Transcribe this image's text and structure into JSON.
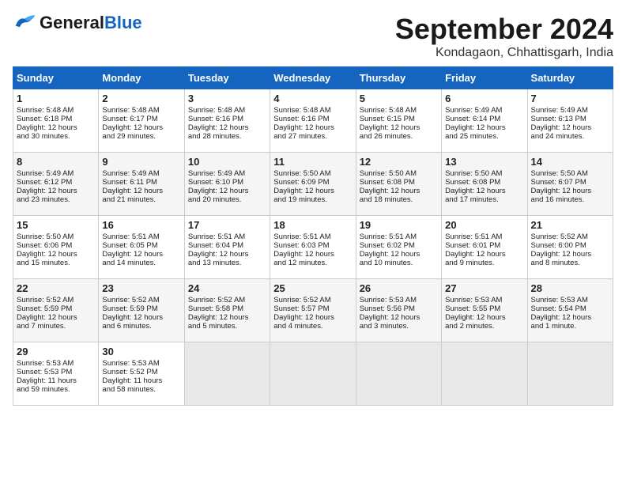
{
  "header": {
    "logo_general": "General",
    "logo_blue": "Blue",
    "month_title": "September 2024",
    "location": "Kondagaon, Chhattisgarh, India"
  },
  "weekdays": [
    "Sunday",
    "Monday",
    "Tuesday",
    "Wednesday",
    "Thursday",
    "Friday",
    "Saturday"
  ],
  "weeks": [
    [
      {
        "day": "1",
        "lines": [
          "Sunrise: 5:48 AM",
          "Sunset: 6:18 PM",
          "Daylight: 12 hours",
          "and 30 minutes."
        ]
      },
      {
        "day": "2",
        "lines": [
          "Sunrise: 5:48 AM",
          "Sunset: 6:17 PM",
          "Daylight: 12 hours",
          "and 29 minutes."
        ]
      },
      {
        "day": "3",
        "lines": [
          "Sunrise: 5:48 AM",
          "Sunset: 6:16 PM",
          "Daylight: 12 hours",
          "and 28 minutes."
        ]
      },
      {
        "day": "4",
        "lines": [
          "Sunrise: 5:48 AM",
          "Sunset: 6:16 PM",
          "Daylight: 12 hours",
          "and 27 minutes."
        ]
      },
      {
        "day": "5",
        "lines": [
          "Sunrise: 5:48 AM",
          "Sunset: 6:15 PM",
          "Daylight: 12 hours",
          "and 26 minutes."
        ]
      },
      {
        "day": "6",
        "lines": [
          "Sunrise: 5:49 AM",
          "Sunset: 6:14 PM",
          "Daylight: 12 hours",
          "and 25 minutes."
        ]
      },
      {
        "day": "7",
        "lines": [
          "Sunrise: 5:49 AM",
          "Sunset: 6:13 PM",
          "Daylight: 12 hours",
          "and 24 minutes."
        ]
      }
    ],
    [
      {
        "day": "8",
        "lines": [
          "Sunrise: 5:49 AM",
          "Sunset: 6:12 PM",
          "Daylight: 12 hours",
          "and 23 minutes."
        ]
      },
      {
        "day": "9",
        "lines": [
          "Sunrise: 5:49 AM",
          "Sunset: 6:11 PM",
          "Daylight: 12 hours",
          "and 21 minutes."
        ]
      },
      {
        "day": "10",
        "lines": [
          "Sunrise: 5:49 AM",
          "Sunset: 6:10 PM",
          "Daylight: 12 hours",
          "and 20 minutes."
        ]
      },
      {
        "day": "11",
        "lines": [
          "Sunrise: 5:50 AM",
          "Sunset: 6:09 PM",
          "Daylight: 12 hours",
          "and 19 minutes."
        ]
      },
      {
        "day": "12",
        "lines": [
          "Sunrise: 5:50 AM",
          "Sunset: 6:08 PM",
          "Daylight: 12 hours",
          "and 18 minutes."
        ]
      },
      {
        "day": "13",
        "lines": [
          "Sunrise: 5:50 AM",
          "Sunset: 6:08 PM",
          "Daylight: 12 hours",
          "and 17 minutes."
        ]
      },
      {
        "day": "14",
        "lines": [
          "Sunrise: 5:50 AM",
          "Sunset: 6:07 PM",
          "Daylight: 12 hours",
          "and 16 minutes."
        ]
      }
    ],
    [
      {
        "day": "15",
        "lines": [
          "Sunrise: 5:50 AM",
          "Sunset: 6:06 PM",
          "Daylight: 12 hours",
          "and 15 minutes."
        ]
      },
      {
        "day": "16",
        "lines": [
          "Sunrise: 5:51 AM",
          "Sunset: 6:05 PM",
          "Daylight: 12 hours",
          "and 14 minutes."
        ]
      },
      {
        "day": "17",
        "lines": [
          "Sunrise: 5:51 AM",
          "Sunset: 6:04 PM",
          "Daylight: 12 hours",
          "and 13 minutes."
        ]
      },
      {
        "day": "18",
        "lines": [
          "Sunrise: 5:51 AM",
          "Sunset: 6:03 PM",
          "Daylight: 12 hours",
          "and 12 minutes."
        ]
      },
      {
        "day": "19",
        "lines": [
          "Sunrise: 5:51 AM",
          "Sunset: 6:02 PM",
          "Daylight: 12 hours",
          "and 10 minutes."
        ]
      },
      {
        "day": "20",
        "lines": [
          "Sunrise: 5:51 AM",
          "Sunset: 6:01 PM",
          "Daylight: 12 hours",
          "and 9 minutes."
        ]
      },
      {
        "day": "21",
        "lines": [
          "Sunrise: 5:52 AM",
          "Sunset: 6:00 PM",
          "Daylight: 12 hours",
          "and 8 minutes."
        ]
      }
    ],
    [
      {
        "day": "22",
        "lines": [
          "Sunrise: 5:52 AM",
          "Sunset: 5:59 PM",
          "Daylight: 12 hours",
          "and 7 minutes."
        ]
      },
      {
        "day": "23",
        "lines": [
          "Sunrise: 5:52 AM",
          "Sunset: 5:59 PM",
          "Daylight: 12 hours",
          "and 6 minutes."
        ]
      },
      {
        "day": "24",
        "lines": [
          "Sunrise: 5:52 AM",
          "Sunset: 5:58 PM",
          "Daylight: 12 hours",
          "and 5 minutes."
        ]
      },
      {
        "day": "25",
        "lines": [
          "Sunrise: 5:52 AM",
          "Sunset: 5:57 PM",
          "Daylight: 12 hours",
          "and 4 minutes."
        ]
      },
      {
        "day": "26",
        "lines": [
          "Sunrise: 5:53 AM",
          "Sunset: 5:56 PM",
          "Daylight: 12 hours",
          "and 3 minutes."
        ]
      },
      {
        "day": "27",
        "lines": [
          "Sunrise: 5:53 AM",
          "Sunset: 5:55 PM",
          "Daylight: 12 hours",
          "and 2 minutes."
        ]
      },
      {
        "day": "28",
        "lines": [
          "Sunrise: 5:53 AM",
          "Sunset: 5:54 PM",
          "Daylight: 12 hours",
          "and 1 minute."
        ]
      }
    ],
    [
      {
        "day": "29",
        "lines": [
          "Sunrise: 5:53 AM",
          "Sunset: 5:53 PM",
          "Daylight: 11 hours",
          "and 59 minutes."
        ]
      },
      {
        "day": "30",
        "lines": [
          "Sunrise: 5:53 AM",
          "Sunset: 5:52 PM",
          "Daylight: 11 hours",
          "and 58 minutes."
        ]
      },
      null,
      null,
      null,
      null,
      null
    ]
  ]
}
